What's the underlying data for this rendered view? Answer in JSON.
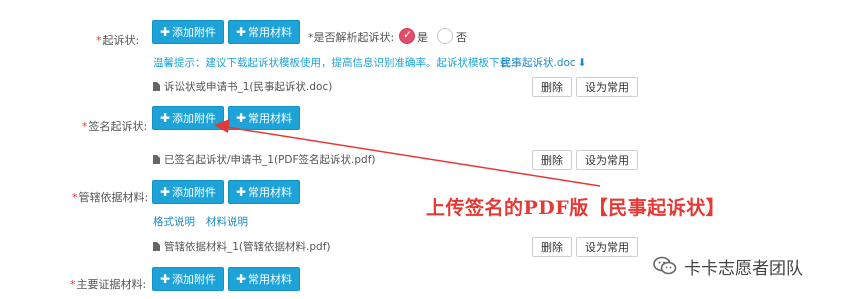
{
  "rows": {
    "complaint": {
      "label": "起诉状:",
      "add_button": "添加附件",
      "common_button": "常用材料",
      "parse_question": "*是否解析起诉状:",
      "radio_yes": "是",
      "radio_no": "否",
      "hint": "温馨提示：建议下载起诉状模板使用，提高信息识别准确率。起诉状模板下载：",
      "template_link": "民事起诉状.doc",
      "file_name": "诉讼状或申请书_1(民事起诉状.doc)",
      "delete_button": "删除",
      "set_common_button": "设为常用"
    },
    "signed_complaint": {
      "label": "签名起诉状:",
      "add_button": "添加附件",
      "common_button": "常用材料",
      "file_name": "已签名起诉状/申请书_1(PDF签名起诉状.pdf)",
      "delete_button": "删除",
      "set_common_button": "设为常用"
    },
    "jurisdiction": {
      "label": "管辖依据材料:",
      "add_button": "添加附件",
      "common_button": "常用材料",
      "format_link": "格式说明",
      "material_link": "材料说明",
      "file_name": "管辖依据材料_1(管辖依据材料.pdf)",
      "delete_button": "删除",
      "set_common_button": "设为常用"
    },
    "evidence": {
      "label": "主要证据材料:",
      "add_button": "添加附件",
      "common_button": "常用材料"
    }
  },
  "annotation": {
    "text": "上传签名的PDF版【民事起诉状】",
    "color": "#e53935"
  },
  "watermark": {
    "text": "卡卡志愿者团队"
  },
  "colors": {
    "primary_button": "#1ea3d9",
    "required_mark": "#e53935",
    "radio_selected": "#e0506a",
    "hint_text": "#1ea3d9"
  }
}
